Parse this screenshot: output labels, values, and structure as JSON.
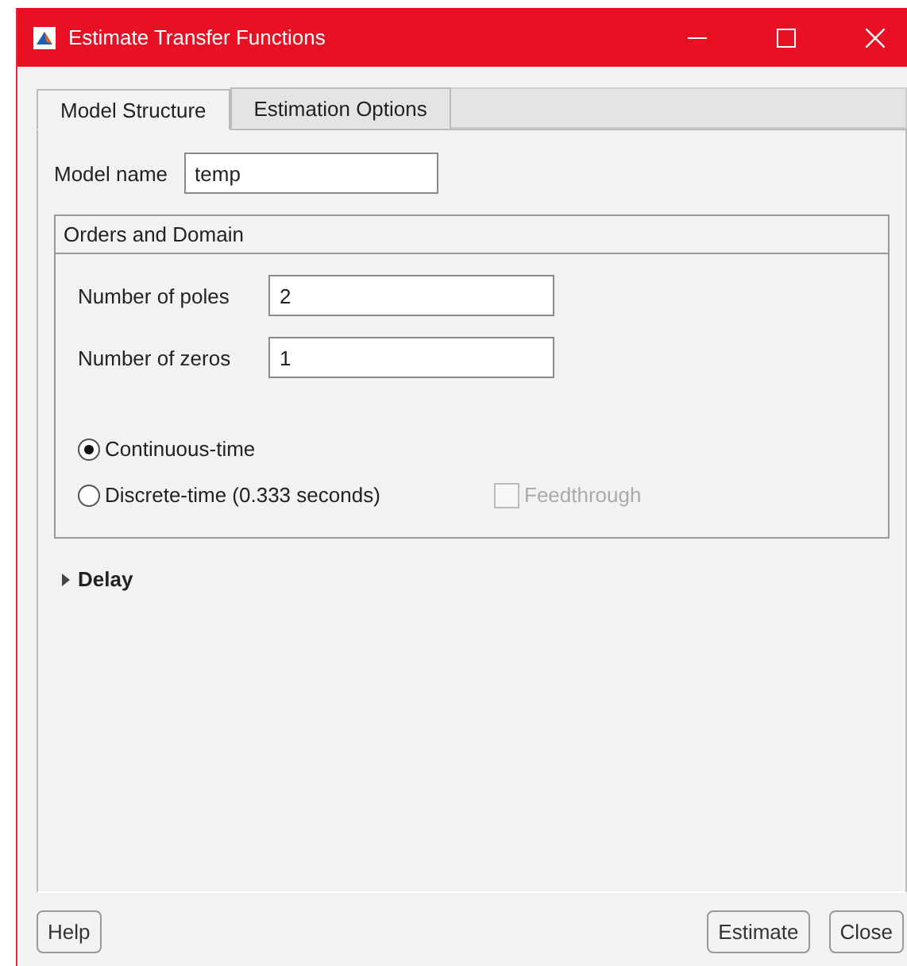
{
  "window": {
    "title": "Estimate Transfer Functions"
  },
  "tabs": [
    {
      "label": "Model Structure",
      "selected": true
    },
    {
      "label": "Estimation Options",
      "selected": false
    }
  ],
  "model_name": {
    "label": "Model name",
    "value": "temp"
  },
  "orders_and_domain": {
    "title": "Orders and Domain",
    "fields": [
      {
        "label": "Number of poles",
        "value": "2"
      },
      {
        "label": "Number of zeros",
        "value": "1"
      }
    ],
    "domain": [
      {
        "label": "Continuous-time",
        "selected": true
      },
      {
        "label": "Discrete-time (0.333 seconds)",
        "selected": false
      }
    ],
    "feedthrough": {
      "label": "Feedthrough",
      "checked": false,
      "disabled": true
    }
  },
  "delay": {
    "label": "Delay",
    "expanded": false
  },
  "buttons": {
    "left": [
      "Help"
    ],
    "right": [
      "Estimate",
      "Close"
    ]
  }
}
